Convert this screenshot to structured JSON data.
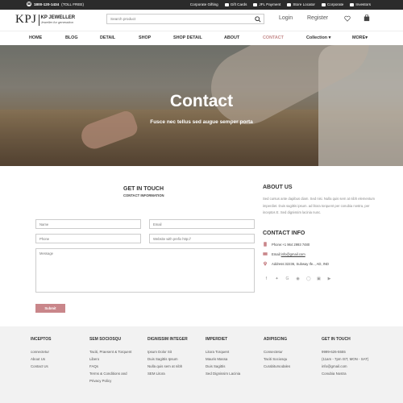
{
  "topbar": {
    "phone": "1800-120-1434",
    "toll_free": "(TOLL FREE)",
    "links": [
      "Corporate Gifting",
      "Gift Cards",
      "JFL Payment",
      "Store Locator",
      "Corporate",
      "Investors"
    ]
  },
  "header": {
    "logo_big": "KPJ",
    "logo_name": "KP JEWELLER",
    "logo_tagline": "Jeweller for generation",
    "search_placeholder": "Search product",
    "login": "Login",
    "register": "Register"
  },
  "nav": {
    "items": [
      "HOME",
      "BLOG",
      "DETAIL",
      "SHOP",
      "SHOP DETAIL",
      "ABOUT",
      "CONTACT",
      "Collection",
      "MORE"
    ],
    "active": "CONTACT"
  },
  "hero": {
    "title": "Contact",
    "subtitle": "Fusce nec tellus sed augue semper porta"
  },
  "form": {
    "title": "GET IN TOUCH",
    "subtitle": "CONTACT INFORMATION",
    "name_placeholder": "Name",
    "email_placeholder": "Email",
    "phone_placeholder": "Phone",
    "website_placeholder": "Website with prefix http://",
    "message_placeholder": "Message",
    "submit_label": "Submit"
  },
  "about": {
    "title": "ABOUT US",
    "text": "Sed cursus ante dapibus diam. Sed nisi. Nulla quis sem at nibh elementum imperdiet. Duis sagittis ipsum. ad litora torquent per conubia nostra, per inceptos E. Sed dignissim lacinia nunc."
  },
  "contact_info": {
    "title": "CONTACT INFO",
    "phone": "Phone:+1 964 2993 7480",
    "email_prefix": "Email:",
    "email": "info@gmail.com",
    "address": "Address:32236, Subway Ife.., AD, IND"
  },
  "socials": [
    "facebook-icon",
    "twitter-icon",
    "google-icon",
    "pinterest-icon",
    "instagram-icon",
    "linkedin-icon",
    "youtube-icon"
  ],
  "footer": {
    "columns": [
      {
        "title": "INCEPTOS",
        "items": [
          "connectetur",
          "About Us",
          "Contact Us"
        ]
      },
      {
        "title": "SEM SOCIOSQU",
        "items": [
          "Taciti, Praesent & Torquent Libero",
          "FAQs",
          "Terms & Conditions and Privacy Policy"
        ]
      },
      {
        "title": "DIGNISSIM INTEGER",
        "items": [
          "Ipsum Dolor Sit",
          "Duis Sagittis Ipsum",
          "Nulla quis sem at nibh",
          "SEM Litora"
        ]
      },
      {
        "title": "IMPERDIET",
        "items": [
          "Litora Torquent",
          "Mauris Massa",
          "Duis Sagittis",
          "Sed Dignissim Lacinia"
        ]
      },
      {
        "title": "ADIPISCING",
        "items": [
          "Consectetur",
          "Taciti Sociosqu",
          "Curabitursodales"
        ]
      },
      {
        "title": "GET IN TOUCH",
        "items": [
          "9999-626-5555",
          "(11am - 7pm IST, MON - SAT)",
          "info@gmail.com",
          "Conubia Nostra"
        ]
      }
    ]
  }
}
